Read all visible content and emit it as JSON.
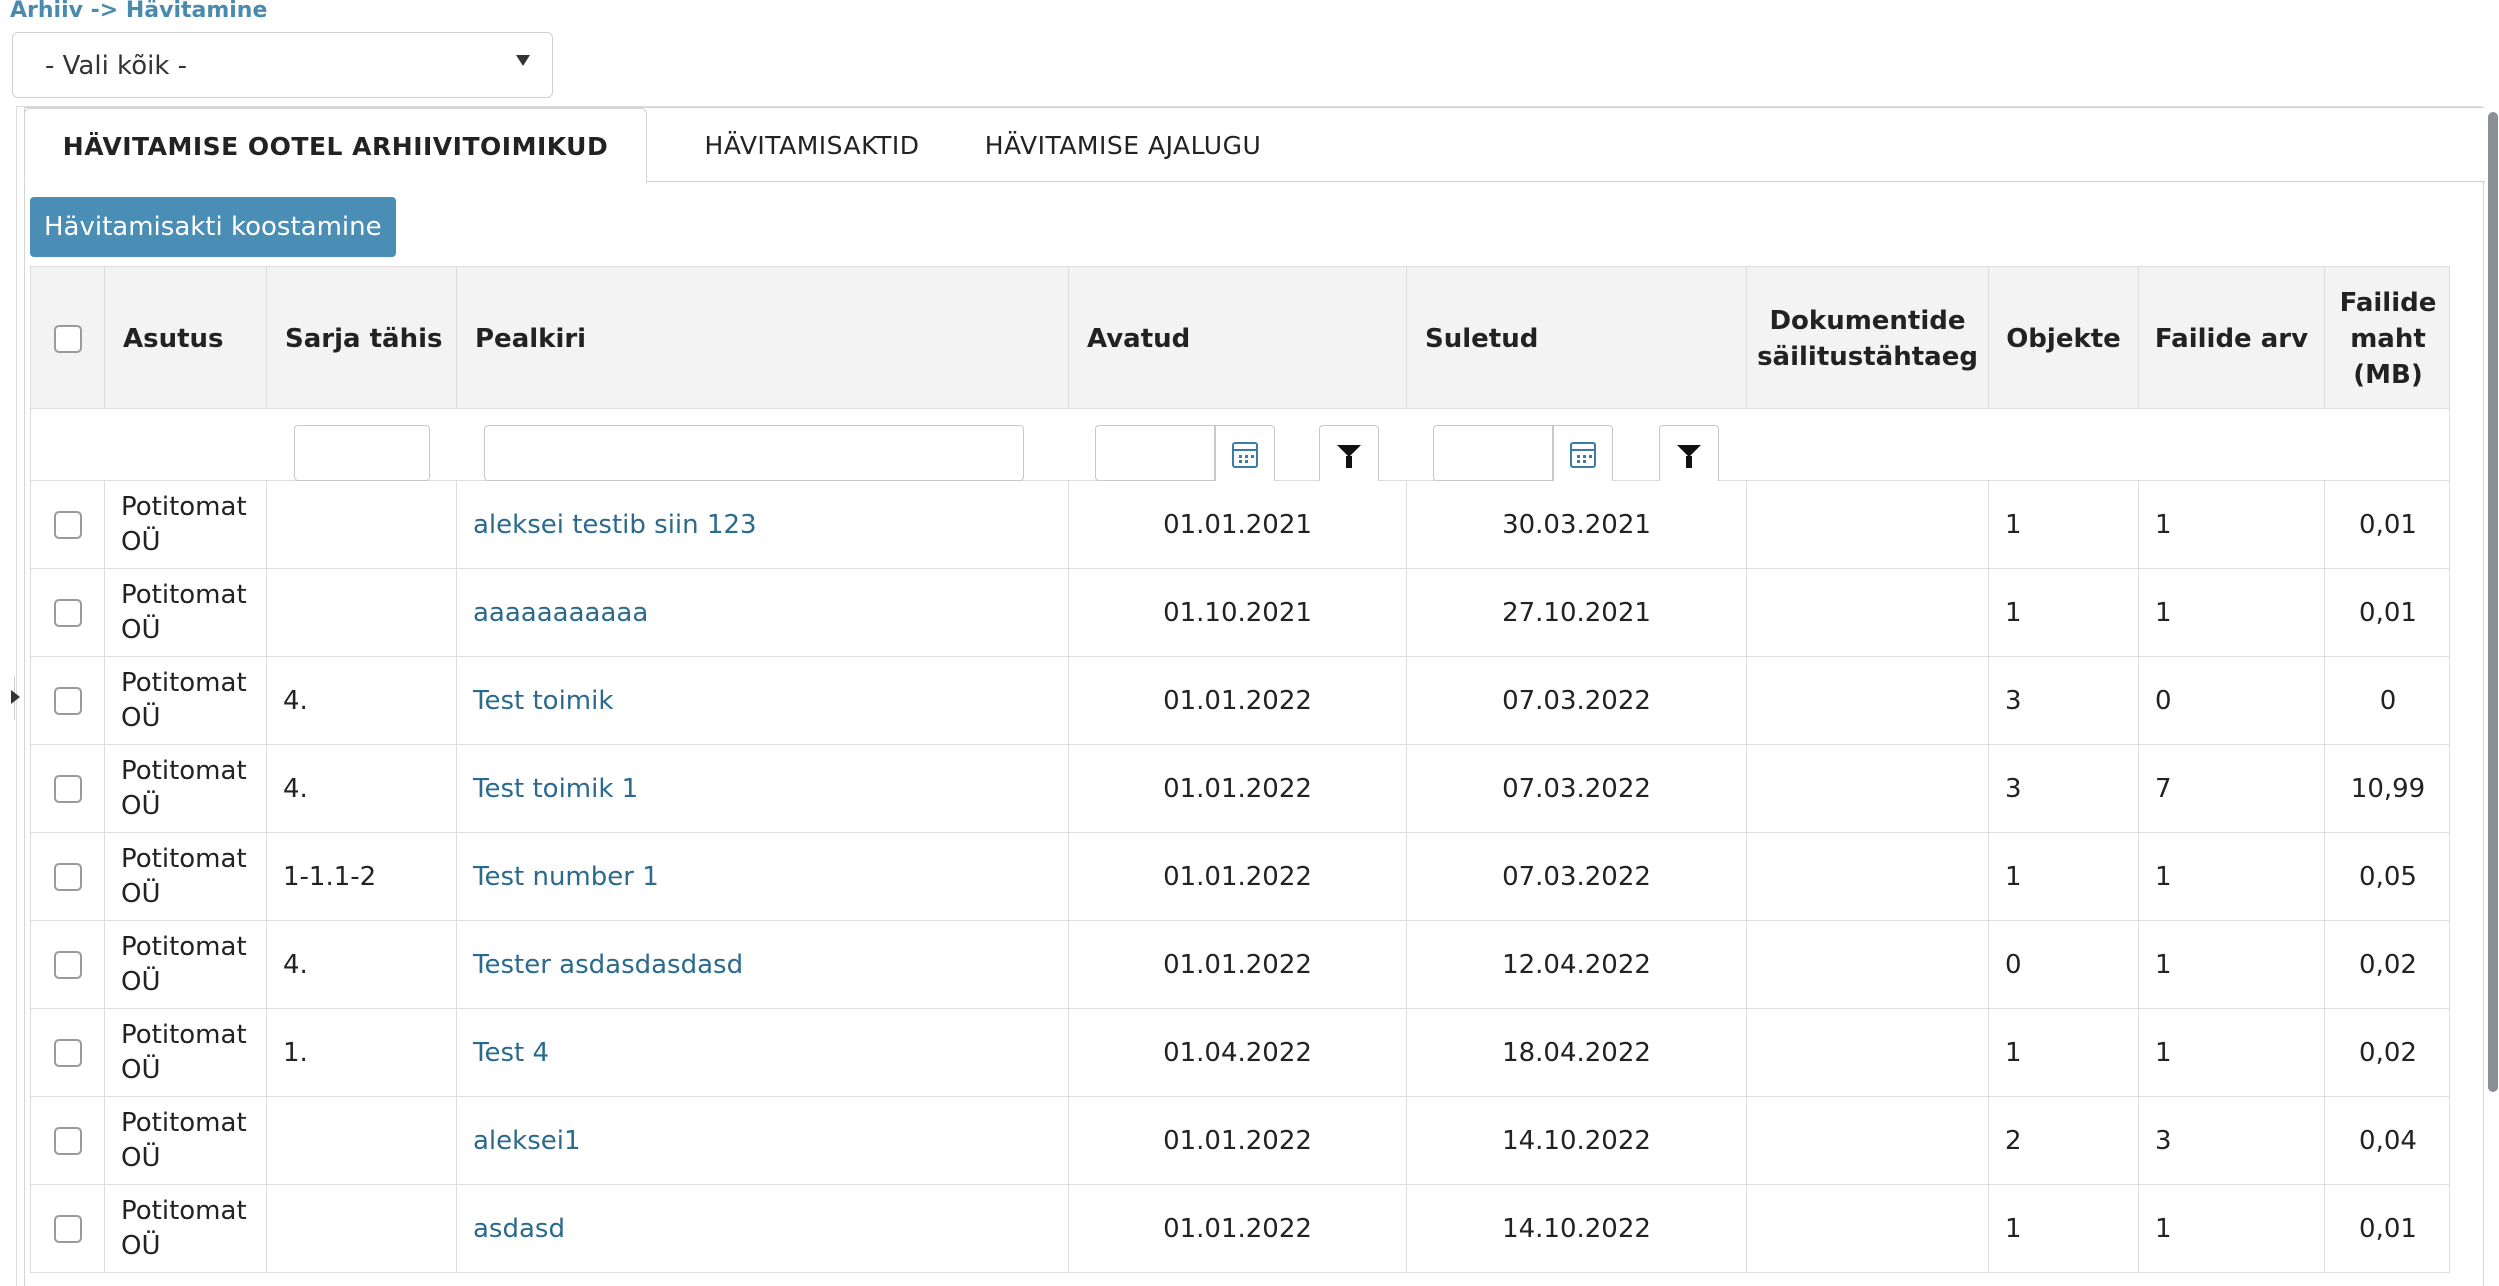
{
  "breadcrumb": "Arhiiv -> Hävitamine",
  "select": {
    "value": "- Vali kõik -"
  },
  "tabs": [
    {
      "label": "HÄVITAMISE OOTEL ARHIIVITOIMIKUD",
      "active": true
    },
    {
      "label": "HÄVITAMISAKTID",
      "active": false
    },
    {
      "label": "HÄVITAMISE AJALUGU",
      "active": false
    }
  ],
  "create_button": "Hävitamisakti koostamine",
  "table": {
    "headers": {
      "asutus": "Asutus",
      "sarja": "Sarja tähis",
      "pealkiri": "Pealkiri",
      "avatud": "Avatud",
      "suletud": "Suletud",
      "dokumentide": "Dokumentide säilitustähtaeg",
      "objekte": "Objekte",
      "failide_arv": "Failide arv",
      "failide_maht": "Failide maht (MB)"
    },
    "rows": [
      {
        "asutus": "Potitomat OÜ",
        "sarja": "",
        "pealkiri": "aleksei testib siin 123",
        "avatud": "01.01.2021",
        "suletud": "30.03.2021",
        "dok": "",
        "objekte": "1",
        "arv": "1",
        "maht": "0,01"
      },
      {
        "asutus": "Potitomat OÜ",
        "sarja": "",
        "pealkiri": "aaaaaaaaaaa",
        "avatud": "01.10.2021",
        "suletud": "27.10.2021",
        "dok": "",
        "objekte": "1",
        "arv": "1",
        "maht": "0,01"
      },
      {
        "asutus": "Potitomat OÜ",
        "sarja": "4.",
        "pealkiri": "Test toimik",
        "avatud": "01.01.2022",
        "suletud": "07.03.2022",
        "dok": "",
        "objekte": "3",
        "arv": "0",
        "maht": "0"
      },
      {
        "asutus": "Potitomat OÜ",
        "sarja": "4.",
        "pealkiri": "Test toimik 1",
        "avatud": "01.01.2022",
        "suletud": "07.03.2022",
        "dok": "",
        "objekte": "3",
        "arv": "7",
        "maht": "10,99"
      },
      {
        "asutus": "Potitomat OÜ",
        "sarja": "1-1.1-2",
        "pealkiri": "Test number 1",
        "avatud": "01.01.2022",
        "suletud": "07.03.2022",
        "dok": "",
        "objekte": "1",
        "arv": "1",
        "maht": "0,05"
      },
      {
        "asutus": "Potitomat OÜ",
        "sarja": "4.",
        "pealkiri": "Tester asdasdasdasd",
        "avatud": "01.01.2022",
        "suletud": "12.04.2022",
        "dok": "",
        "objekte": "0",
        "arv": "1",
        "maht": "0,02"
      },
      {
        "asutus": "Potitomat OÜ",
        "sarja": "1.",
        "pealkiri": "Test 4",
        "avatud": "01.04.2022",
        "suletud": "18.04.2022",
        "dok": "",
        "objekte": "1",
        "arv": "1",
        "maht": "0,02"
      },
      {
        "asutus": "Potitomat OÜ",
        "sarja": "",
        "pealkiri": "aleksei1",
        "avatud": "01.01.2022",
        "suletud": "14.10.2022",
        "dok": "",
        "objekte": "2",
        "arv": "3",
        "maht": "0,04"
      },
      {
        "asutus": "Potitomat OÜ",
        "sarja": "",
        "pealkiri": "asdasd",
        "avatud": "01.01.2022",
        "suletud": "14.10.2022",
        "dok": "",
        "objekte": "1",
        "arv": "1",
        "maht": "0,01"
      }
    ]
  }
}
